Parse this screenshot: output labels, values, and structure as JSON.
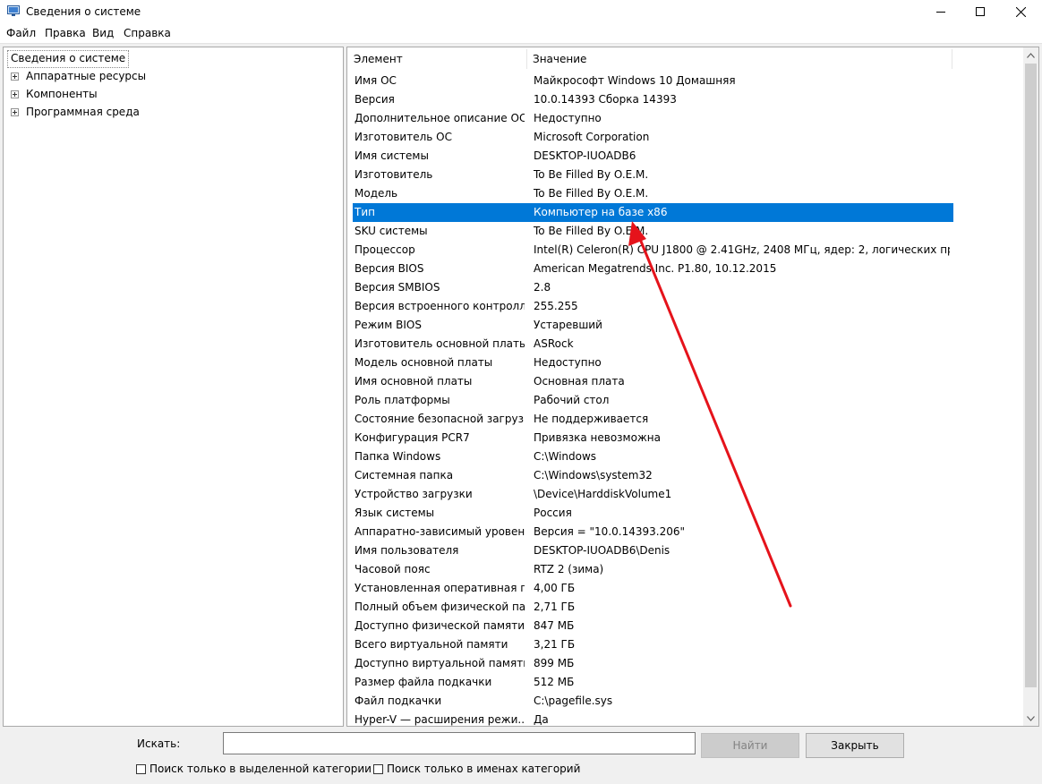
{
  "window": {
    "title": "Сведения о системе",
    "controls": {
      "minimize": "minimize-icon",
      "maximize": "maximize-icon",
      "close": "close-icon"
    }
  },
  "menu": [
    "Файл",
    "Правка",
    "Вид",
    "Справка"
  ],
  "tree": {
    "root": "Сведения о системе",
    "children": [
      "Аппаратные ресурсы",
      "Компоненты",
      "Программная среда"
    ]
  },
  "list": {
    "columns": [
      "Элемент",
      "Значение"
    ],
    "selected_index": 7,
    "rows": [
      [
        "Имя ОС",
        "Майкрософт Windows 10 Домашняя"
      ],
      [
        "Версия",
        "10.0.14393 Сборка 14393"
      ],
      [
        "Дополнительное описание ОС",
        "Недоступно"
      ],
      [
        "Изготовитель ОС",
        "Microsoft Corporation"
      ],
      [
        "Имя системы",
        "DESKTOP-IUOADB6"
      ],
      [
        "Изготовитель",
        "To Be Filled By O.E.M."
      ],
      [
        "Модель",
        "To Be Filled By O.E.M."
      ],
      [
        "Тип",
        "Компьютер на базе x86"
      ],
      [
        "SKU системы",
        "To Be Filled By O.E.M."
      ],
      [
        "Процессор",
        "Intel(R) Celeron(R) CPU  J1800  @ 2.41GHz, 2408 МГц, ядер: 2, логических пр..."
      ],
      [
        "Версия BIOS",
        "American Megatrends Inc. P1.80, 10.12.2015"
      ],
      [
        "Версия SMBIOS",
        "2.8"
      ],
      [
        "Версия встроенного контролл...",
        "255.255"
      ],
      [
        "Режим BIOS",
        "Устаревший"
      ],
      [
        "Изготовитель основной платы",
        "ASRock"
      ],
      [
        "Модель основной платы",
        "Недоступно"
      ],
      [
        "Имя основной платы",
        "Основная плата"
      ],
      [
        "Роль платформы",
        "Рабочий стол"
      ],
      [
        "Состояние безопасной загруз...",
        "Не поддерживается"
      ],
      [
        "Конфигурация PCR7",
        "Привязка невозможна"
      ],
      [
        "Папка Windows",
        "C:\\Windows"
      ],
      [
        "Системная папка",
        "C:\\Windows\\system32"
      ],
      [
        "Устройство загрузки",
        "\\Device\\HarddiskVolume1"
      ],
      [
        "Язык системы",
        "Россия"
      ],
      [
        "Аппаратно-зависимый уровен...",
        "Версия = \"10.0.14393.206\""
      ],
      [
        "Имя пользователя",
        "DESKTOP-IUOADB6\\Denis"
      ],
      [
        "Часовой пояс",
        "RTZ 2 (зима)"
      ],
      [
        "Установленная оперативная п...",
        "4,00 ГБ"
      ],
      [
        "Полный объем физической па...",
        "2,71 ГБ"
      ],
      [
        "Доступно физической памяти",
        "847 МБ"
      ],
      [
        "Всего виртуальной памяти",
        "3,21 ГБ"
      ],
      [
        "Доступно виртуальной памяти",
        "899 МБ"
      ],
      [
        "Размер файла подкачки",
        "512 МБ"
      ],
      [
        "Файл подкачки",
        "C:\\pagefile.sys"
      ],
      [
        "Hyper-V — расширения режи...",
        "Да"
      ]
    ]
  },
  "search": {
    "label": "Искать:",
    "value": "",
    "find_button": "Найти",
    "close_button": "Закрыть",
    "checkbox_selected_category": "Поиск только в выделенной категории",
    "checkbox_category_names": "Поиск только в именах категорий",
    "checkbox_selected_category_checked": false,
    "checkbox_category_names_checked": false
  },
  "colors": {
    "selection": "#0078d7",
    "annotation_arrow": "#e5131b"
  }
}
